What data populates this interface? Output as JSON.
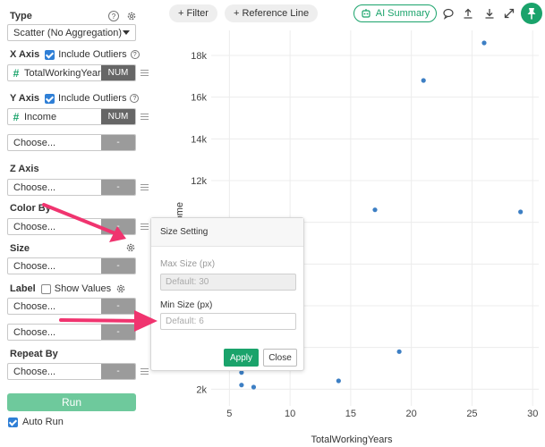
{
  "panel": {
    "type_title": "Type",
    "type_select": "Scatter (No Aggregation)",
    "x_axis": {
      "title": "X Axis",
      "include_outliers": "Include Outliers",
      "field": "TotalWorkingYears",
      "field_type": "NUM"
    },
    "y_axis": {
      "title": "Y Axis",
      "include_outliers": "Include Outliers",
      "field": "Income",
      "field_type": "NUM",
      "second_choose": "Choose...",
      "second_type": "-"
    },
    "z_axis": {
      "title": "Z Axis",
      "choose": "Choose...",
      "type": "-"
    },
    "color_by": {
      "title": "Color By",
      "choose": "Choose...",
      "type": "-"
    },
    "size": {
      "title": "Size",
      "choose": "Choose...",
      "type": "-"
    },
    "label": {
      "title": "Label",
      "show_values": "Show Values",
      "choose1": "Choose...",
      "type1": "-",
      "choose2": "Choose...",
      "type2": "-"
    },
    "repeat_by": {
      "title": "Repeat By",
      "choose": "Choose...",
      "type": "-"
    },
    "run": "Run",
    "auto_run": "Auto Run"
  },
  "toolbar": {
    "filter": "+ Filter",
    "reference_line": "+ Reference Line",
    "ai_summary": "AI Summary"
  },
  "popover": {
    "title": "Size Setting",
    "max_label": "Max Size (px)",
    "max_placeholder": "Default: 30",
    "min_label": "Min Size (px)",
    "min_placeholder": "Default: 6",
    "apply": "Apply",
    "close": "Close"
  },
  "colors": {
    "accent": "#1aa36b",
    "point": "#3d7fc4",
    "arrow": "#f0346f"
  },
  "chart_data": {
    "type": "scatter",
    "xlabel": "TotalWorkingYears",
    "ylabel": "Income",
    "xlim": [
      3.5,
      30.5
    ],
    "ylim": [
      1200,
      19200
    ],
    "x_ticks": [
      5,
      10,
      15,
      20,
      25,
      30
    ],
    "x_tick_labels": [
      "5",
      "10",
      "15",
      "20",
      "25",
      "30"
    ],
    "y_ticks": [
      2000,
      4000,
      6000,
      8000,
      10000,
      12000,
      14000,
      16000,
      18000
    ],
    "y_tick_labels": [
      "2k",
      "",
      "",
      "",
      "",
      "12k",
      "14k",
      "16k",
      "18k"
    ],
    "grid": true,
    "points": [
      {
        "x": 26,
        "y": 18600
      },
      {
        "x": 21,
        "y": 16800
      },
      {
        "x": 17,
        "y": 10600
      },
      {
        "x": 29,
        "y": 10500
      },
      {
        "x": 19,
        "y": 3800
      },
      {
        "x": 14,
        "y": 2400
      },
      {
        "x": 6,
        "y": 2800
      },
      {
        "x": 6,
        "y": 2200
      },
      {
        "x": 7,
        "y": 2100
      }
    ]
  }
}
